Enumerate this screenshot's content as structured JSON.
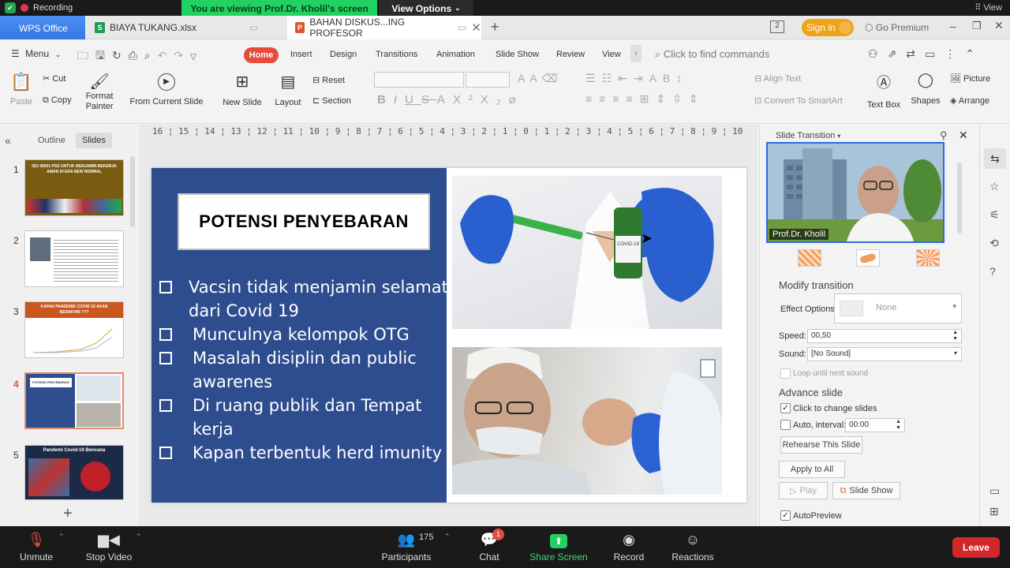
{
  "zoom_top": {
    "recording": "Recording",
    "viewing_banner": "You are viewing Prof.Dr. Kholil's screen",
    "view_options": "View Options",
    "view": "View"
  },
  "titlebar": {
    "app": "WPS Office",
    "tabs": [
      {
        "label": "BIAYA TUKANG.xlsx"
      },
      {
        "label": "BAHAN DISKUS...ING PROFESOR"
      }
    ],
    "sign_in": "Sign in",
    "go_premium": "Go Premium"
  },
  "menubar": {
    "menu": "Menu",
    "tabs": [
      "Home",
      "Insert",
      "Design",
      "Transitions",
      "Animation",
      "Slide Show",
      "Review",
      "View"
    ],
    "search_placeholder": "Click to find commands"
  },
  "ribbon": {
    "paste": "Paste",
    "cut": "Cut",
    "copy": "Copy",
    "format_painter": "Format Painter",
    "from_current_slide": "From Current Slide",
    "new_slide": "New Slide",
    "layout": "Layout",
    "reset": "Reset",
    "section": "Section",
    "align_text": "Align Text",
    "convert_smartart": "Convert To SmartArt",
    "text_box": "Text Box",
    "shapes": "Shapes",
    "picture": "Picture",
    "arrange": "Arrange"
  },
  "leftpanel": {
    "tabs": [
      "Outline",
      "Slides"
    ],
    "slides": [
      {
        "num": "1",
        "title": "ISO 45001 PSS UNTUK MENJAMIN BEKERJA AMAN DI ERA NEW NORMAL"
      },
      {
        "num": "2",
        "title": ""
      },
      {
        "num": "3",
        "title": "KAPAN PANDEMIC COVID 19 AKAN BERAKHIR ???"
      },
      {
        "num": "4",
        "title": "POTENSI PENYEBARAN"
      },
      {
        "num": "5",
        "title": "Pandemi Covid-19 Bencana"
      }
    ]
  },
  "ruler": "16 ¦ 15 ¦ 14 ¦ 13 ¦ 12 ¦ 11 ¦ 10 ¦ 9 ¦ 8 ¦ 7 ¦ 6 ¦ 5 ¦ 4 ¦ 3 ¦ 2 ¦ 1 ¦ 0 ¦ 1 ¦ 2 ¦ 3 ¦ 4 ¦ 5 ¦ 6 ¦ 7 ¦ 8 ¦ 9 ¦ 10 ¦ 11 ¦ 12 ¦ 13 ¦ 14 ¦ 15 ¦ 16",
  "slide": {
    "title": "POTENSI  PENYEBARAN",
    "bullets": [
      [
        "Vacsin tidak menjamin selamat",
        "dari  Covid 19"
      ],
      [
        "Munculnya   kelompok OTG"
      ],
      [
        "Masalah disiplin dan public",
        "awarenes"
      ],
      [
        "Di ruang publik dan Tempat",
        "kerja"
      ],
      [
        "Kapan terbentuk herd imunity"
      ]
    ],
    "vial_label": "COVID-19 Coronavirus Vaccine"
  },
  "rightpanel": {
    "header": "Slide Transition",
    "video_name": "Prof.Dr. Kholil",
    "modify_transition": "Modify transition",
    "effect_options_label": "Effect Options:",
    "effect_options_value": "None",
    "speed_label": "Speed:",
    "speed_value": "00,50",
    "sound_label": "Sound:",
    "sound_value": "[No Sound]",
    "loop_label": "Loop until next sound",
    "advance_slide": "Advance slide",
    "click_to_change": "Click to change slides",
    "auto_interval_label": "Auto, interval:",
    "auto_interval_value": "00:00",
    "rehearse": "Rehearse This Slide",
    "apply_all": "Apply to All",
    "play": "Play",
    "slide_show": "Slide Show",
    "autopreview": "AutoPreview"
  },
  "zoom_bottom": {
    "unmute": "Unmute",
    "stop_video": "Stop Video",
    "participants": "Participants",
    "participants_count": "175",
    "chat": "Chat",
    "chat_badge": "1",
    "share_screen": "Share Screen",
    "record": "Record",
    "reactions": "Reactions",
    "leave": "Leave"
  },
  "colors": {
    "slide_blue": "#2e4d8f",
    "wps_red": "#e54c3c",
    "zoom_green": "#23d160",
    "leave_red": "#d2272b"
  }
}
